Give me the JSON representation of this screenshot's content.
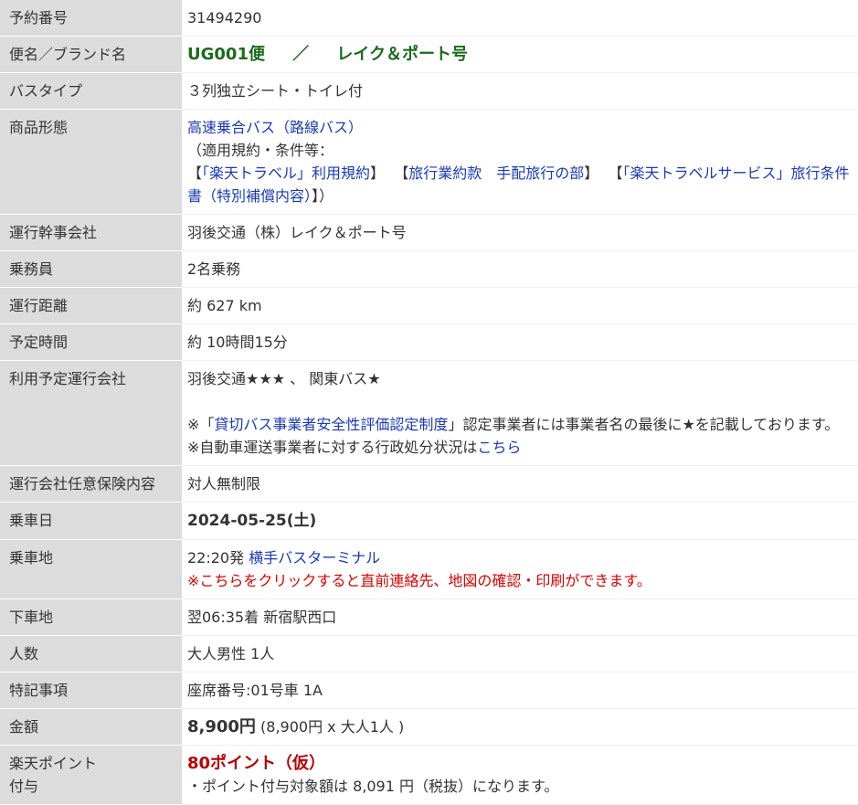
{
  "rows": {
    "reservation_number": {
      "label": "予約番号",
      "value": "31494290"
    },
    "brand": {
      "label": "便名／ブランド名",
      "flight": "UG001便",
      "sep": "／",
      "name": "レイク＆ポート号"
    },
    "bus_type": {
      "label": "バスタイプ",
      "value": "３列独立シート・トイレ付"
    },
    "product": {
      "label": "商品形態",
      "type_link": "高速乗合バス（路線バス）",
      "rules_intro": "（適用規約・条件等：",
      "bracket_open_1": "【",
      "rule1": "「楽天トラベル」利用規約",
      "bracket_close_1": "】",
      "bracket_open_2": "【",
      "rule2": "旅行業約款　手配旅行の部",
      "bracket_close_2": "】",
      "bracket_open_3": "【",
      "rule3": "「楽天トラベルサービス」旅行条件書（特別補償内容）",
      "bracket_close_3": "】）"
    },
    "operator_main": {
      "label": "運行幹事会社",
      "value": "羽後交通（株）レイク＆ポート号"
    },
    "crew": {
      "label": "乗務員",
      "value": "2名乗務"
    },
    "distance": {
      "label": "運行距離",
      "value": "約 627 km"
    },
    "duration": {
      "label": "予定時間",
      "value": "約 10時間15分"
    },
    "operators": {
      "label": "利用予定運行会社",
      "value": "羽後交通★★★ 、 関東バス★",
      "note_prefix": "※「",
      "note_link": "貸切バス事業者安全性評価認定制度",
      "note_suffix": "」認定事業者には事業者名の最後に★を記載しております。",
      "admin_prefix": "※自動車運送事業者に対する行政処分状況は",
      "admin_link": "こちら"
    },
    "insurance": {
      "label": "運行会社任意保険内容",
      "value": "対人無制限"
    },
    "boarding_date": {
      "label": "乗車日",
      "value": "2024-05-25(土)"
    },
    "boarding_place": {
      "label": "乗車地",
      "time": "22:20発 ",
      "place_link": "横手バスターミナル",
      "note": "※こちらをクリックすると直前連絡先、地図の確認・印刷ができます。"
    },
    "alighting_place": {
      "label": "下車地",
      "value": "翌06:35着 新宿駅西口"
    },
    "passengers": {
      "label": "人数",
      "value": "大人男性 1人"
    },
    "special": {
      "label": "特記事項",
      "value": "座席番号:01号車 1A"
    },
    "price": {
      "label": "金額",
      "amount": "8,900円",
      "detail": " (8,900円 x 大人1人 )"
    },
    "points": {
      "label_line1": "楽天ポイント",
      "label_line2": "付与",
      "value": "80ポイント（仮）",
      "note": "・ポイント付与対象額は 8,091 円（税抜）になります。"
    }
  }
}
